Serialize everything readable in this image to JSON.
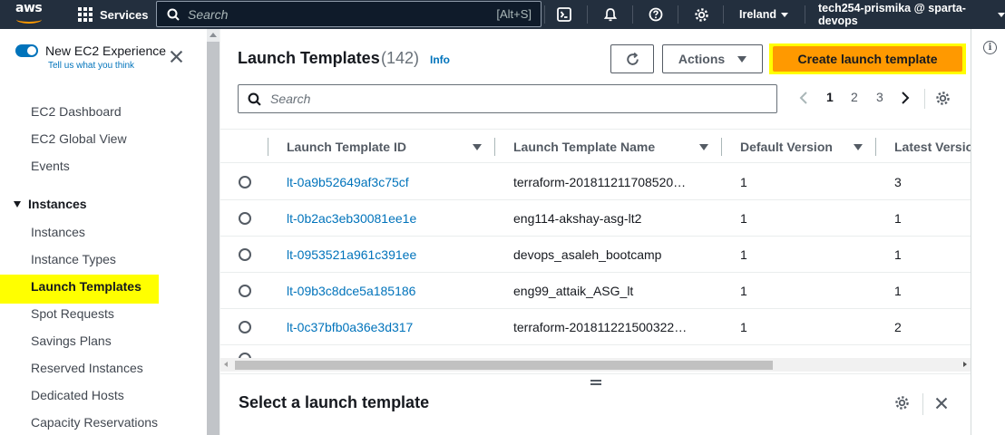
{
  "topnav": {
    "logo_text": "aws",
    "services_label": "Services",
    "search_placeholder": "Search",
    "search_shortcut": "[Alt+S]",
    "region": "Ireland",
    "account": "tech254-prismika @ sparta-devops",
    "icons": [
      "cloudshell-icon",
      "bell-icon",
      "help-icon",
      "gear-icon"
    ]
  },
  "sidebar": {
    "new_experience_title": "New EC2 Experience",
    "new_experience_link": "Tell us what you think",
    "top_items": [
      "EC2 Dashboard",
      "EC2 Global View",
      "Events"
    ],
    "section_label": "Instances",
    "section_items": [
      "Instances",
      "Instance Types",
      "Launch Templates",
      "Spot Requests",
      "Savings Plans",
      "Reserved Instances",
      "Dedicated Hosts",
      "Capacity Reservations"
    ],
    "active_item": "Launch Templates",
    "highlight_color": "#ffff00"
  },
  "main": {
    "title": "Launch Templates",
    "count": "(142)",
    "info_link": "Info",
    "actions_label": "Actions",
    "create_label": "Create launch template",
    "primary_color": "#ff9900",
    "search_placeholder": "Search",
    "pagination": {
      "pages": [
        "1",
        "2",
        "3"
      ],
      "current": "1"
    },
    "columns": [
      "Launch Template ID",
      "Launch Template Name",
      "Default Version",
      "Latest Version"
    ],
    "rows": [
      {
        "id": "lt-0a9b52649af3c75cf",
        "name": "terraform-201811211708520…",
        "default_version": "1",
        "latest_version": "3"
      },
      {
        "id": "lt-0b2ac3eb30081ee1e",
        "name": "eng114-akshay-asg-lt2",
        "default_version": "1",
        "latest_version": "1"
      },
      {
        "id": "lt-0953521a961c391ee",
        "name": "devops_asaleh_bootcamp",
        "default_version": "1",
        "latest_version": "1"
      },
      {
        "id": "lt-09b3c8dce5a185186",
        "name": "eng99_attaik_ASG_lt",
        "default_version": "1",
        "latest_version": "1"
      },
      {
        "id": "lt-0c37bfb0a36e3d317",
        "name": "terraform-201811221500322…",
        "default_version": "1",
        "latest_version": "2"
      }
    ]
  },
  "split_panel": {
    "title": "Select a launch template"
  }
}
